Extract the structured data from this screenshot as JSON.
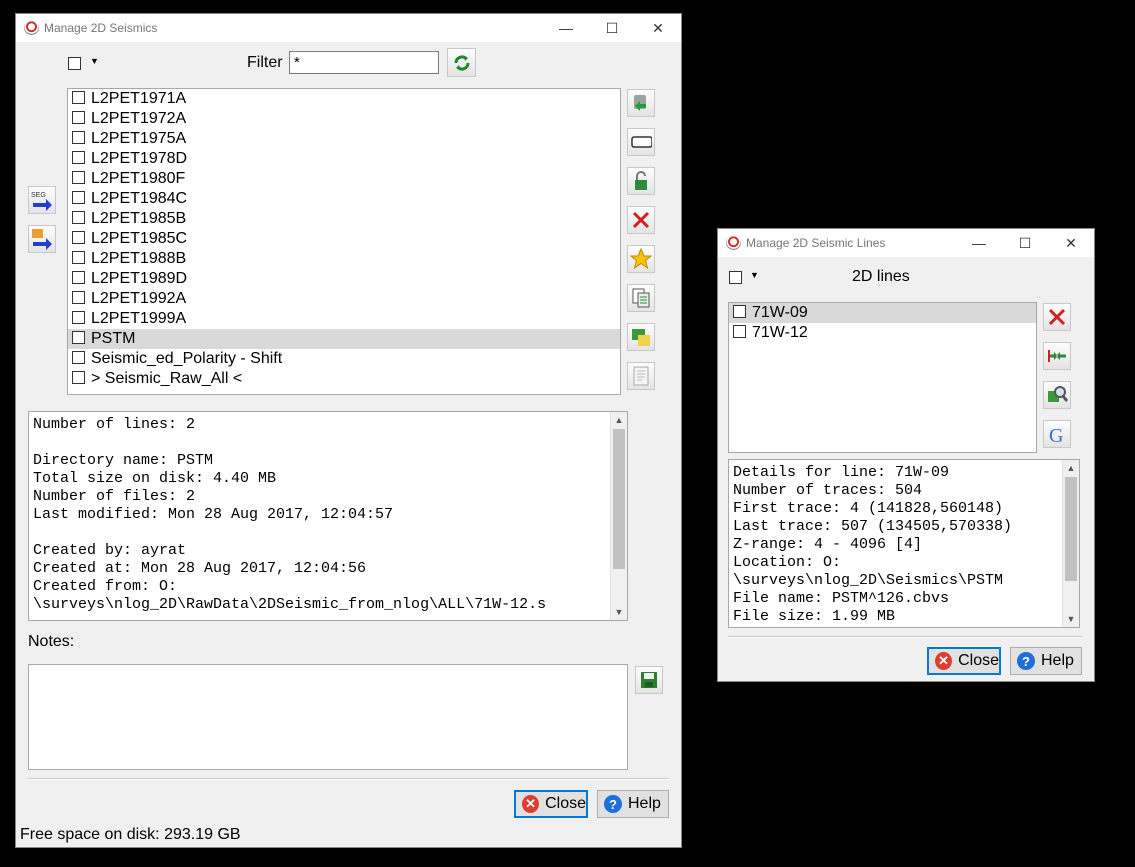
{
  "main": {
    "title": "Manage 2D Seismics",
    "filter_label": "Filter",
    "filter_value": "*",
    "items": [
      {
        "label": "L2PET1971A",
        "selected": false
      },
      {
        "label": "L2PET1972A",
        "selected": false
      },
      {
        "label": "L2PET1975A",
        "selected": false
      },
      {
        "label": "L2PET1978D",
        "selected": false
      },
      {
        "label": "L2PET1980F",
        "selected": false
      },
      {
        "label": "L2PET1984C",
        "selected": false
      },
      {
        "label": "L2PET1985B",
        "selected": false
      },
      {
        "label": "L2PET1985C",
        "selected": false
      },
      {
        "label": "L2PET1988B",
        "selected": false
      },
      {
        "label": "L2PET1989D",
        "selected": false
      },
      {
        "label": "L2PET1992A",
        "selected": false
      },
      {
        "label": "L2PET1999A",
        "selected": false
      },
      {
        "label": "PSTM",
        "selected": true
      },
      {
        "label": "Seismic_ed_Polarity - Shift",
        "selected": false
      },
      {
        "label": "> Seismic_Raw_All <",
        "selected": false
      }
    ],
    "info_lines": [
      "Number of lines: 2",
      "",
      "Directory name: PSTM",
      "Total size on disk: 4.40 MB",
      "Number of files: 2",
      "Last modified: Mon 28 Aug 2017, 12:04:57",
      "",
      "Created by: ayrat",
      "Created at: Mon 28 Aug 2017, 12:04:56",
      "Created from: O:",
      "\\surveys\\nlog_2D\\RawData\\2DSeismic_from_nlog\\ALL\\71W-12.s"
    ],
    "notes_label": "Notes:",
    "close_label": "Close",
    "help_label": "Help",
    "free_space": "Free space on disk: 293.19 GB",
    "left_icons": [
      "segy-import-icon",
      "import-arrow-icon"
    ],
    "right_icons": [
      "copy-to-survey-icon",
      "rename-icon",
      "lock-icon",
      "delete-icon",
      "set-default-icon",
      "copy-icon",
      "merge-icon",
      "report-icon"
    ]
  },
  "lines": {
    "title": "Manage 2D Seismic Lines",
    "header": "2D lines",
    "items": [
      {
        "label": "71W-09",
        "selected": true
      },
      {
        "label": "71W-12",
        "selected": false
      }
    ],
    "info_lines": [
      "Details for line: 71W-09",
      "Number of traces: 504",
      "First trace: 4 (141828,560148)",
      "Last trace: 507 (134505,570338)",
      "Z-range: 4 - 4096 [4]",
      "Location: O:",
      "\\surveys\\nlog_2D\\Seismics\\PSTM",
      "File name: PSTM^126.cbvs",
      "File size: 1.99 MB"
    ],
    "close_label": "Close",
    "help_label": "Help",
    "right_icons": [
      "delete-icon",
      "merge-lines-icon",
      "browse-icon",
      "google-export-icon"
    ]
  },
  "colors": {
    "selected_row": "#d9d9d9",
    "default_button_border": "#0078d7",
    "close_icon": "#e03c31",
    "help_icon": "#1e6fd9"
  }
}
